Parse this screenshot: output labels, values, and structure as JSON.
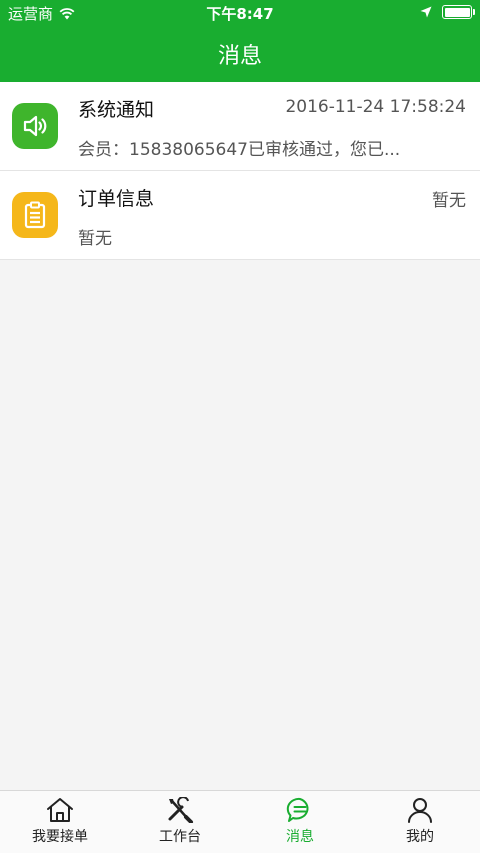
{
  "status_bar": {
    "carrier": "运营商",
    "time": "下午8:47",
    "icons": [
      "wifi-icon",
      "location-arrow-icon",
      "battery-icon"
    ]
  },
  "nav": {
    "title": "消息"
  },
  "messages": [
    {
      "title": "系统通知",
      "time": "2016-11-24 17:58:24",
      "subtitle": "会员：15838065647已审核通过，您已...",
      "icon": "speaker-icon",
      "color": "#3fb52c"
    },
    {
      "title": "订单信息",
      "time": "暂无",
      "subtitle": "暂无",
      "icon": "clipboard-icon",
      "color": "#f5b71a"
    }
  ],
  "tabs": [
    {
      "label": "我要接单",
      "icon": "home-icon",
      "active": false
    },
    {
      "label": "工作台",
      "icon": "tools-icon",
      "active": false
    },
    {
      "label": "消息",
      "icon": "chat-icon",
      "active": true
    },
    {
      "label": "我的",
      "icon": "user-icon",
      "active": false
    }
  ],
  "colors": {
    "brand": "#19ad30",
    "background": "#f4f4f4"
  }
}
